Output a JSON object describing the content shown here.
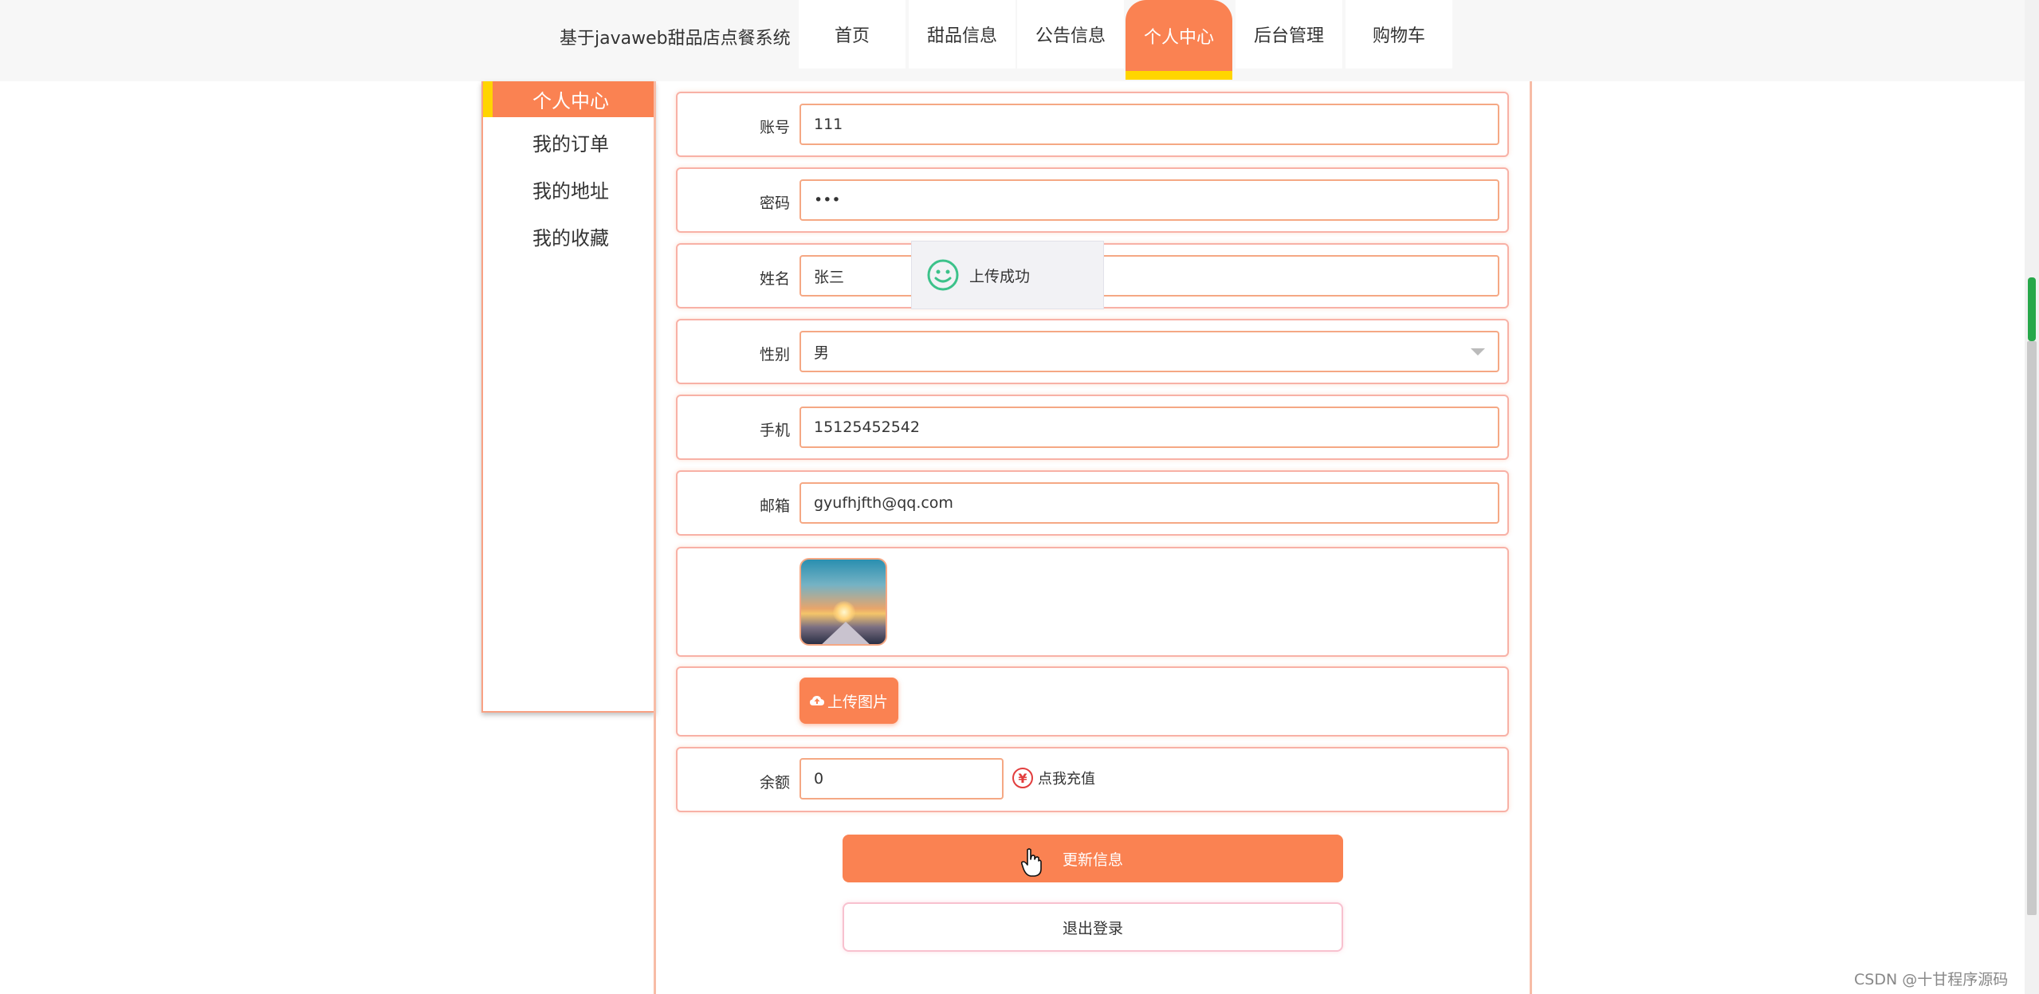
{
  "header": {
    "site_title": "基于javaweb甜品店点餐系统",
    "nav": [
      {
        "label": "首页",
        "active": false
      },
      {
        "label": "甜品信息",
        "active": false
      },
      {
        "label": "公告信息",
        "active": false
      },
      {
        "label": "个人中心",
        "active": true
      },
      {
        "label": "后台管理",
        "active": false
      },
      {
        "label": "购物车",
        "active": false
      }
    ]
  },
  "sidebar": {
    "items": [
      {
        "label": "个人中心",
        "active": true
      },
      {
        "label": "我的订单",
        "active": false
      },
      {
        "label": "我的地址",
        "active": false
      },
      {
        "label": "我的收藏",
        "active": false
      }
    ]
  },
  "form": {
    "account": {
      "label": "账号",
      "value": "111"
    },
    "password": {
      "label": "密码",
      "value": "•••"
    },
    "name": {
      "label": "姓名",
      "value": "张三"
    },
    "gender": {
      "label": "性别",
      "value": "男"
    },
    "phone": {
      "label": "手机",
      "value": "15125452542"
    },
    "email": {
      "label": "邮箱",
      "value": "gyufhjfth@qq.com"
    },
    "upload_label": "上传图片",
    "balance": {
      "label": "余额",
      "value": "0"
    },
    "recharge_label": "点我充值",
    "update_label": "更新信息",
    "logout_label": "退出登录"
  },
  "toast": {
    "message": "上传成功"
  },
  "watermark": "CSDN @十甘程序源码",
  "colors": {
    "accent": "#fa8252",
    "highlight": "#ffd500",
    "success": "#3cc28a"
  }
}
